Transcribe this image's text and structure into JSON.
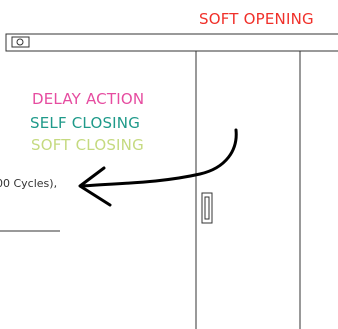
{
  "labels": {
    "soft_opening": "SOFT OPENING",
    "delay_action": "DELAY ACTION",
    "self_closing": "SELF CLOSING",
    "soft_closing": "SOFT CLOSING",
    "cycles_fragment": "00 Cycles),"
  },
  "colors": {
    "soft_opening": "#f0302a",
    "delay_action": "#e64ca0",
    "self_closing": "#1f9a8a",
    "soft_closing": "#c5da80",
    "line": "#333333"
  },
  "icons": {
    "arrow": "hand-drawn-arrow-icon",
    "handle": "door-handle-icon"
  }
}
